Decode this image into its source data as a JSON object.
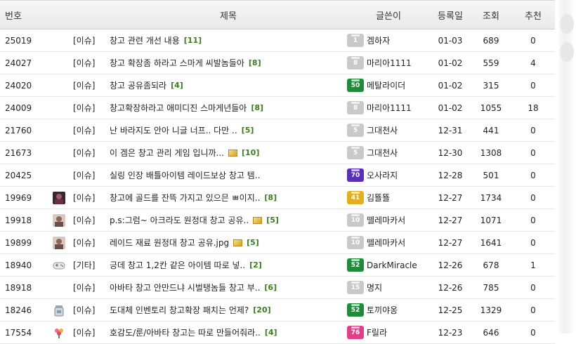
{
  "header": {
    "num": "번호",
    "title": "제목",
    "writer": "글쓴이",
    "date": "등록일",
    "views": "조회",
    "rec": "추천"
  },
  "posts": [
    {
      "num": "25019",
      "thumb": "",
      "cat": "[이슈]",
      "title": "창고 관련 개선 내용",
      "img": false,
      "comments": "[11]",
      "level": "1",
      "level_color": "#c9c9c9",
      "writer": "겜하자",
      "date": "01-03",
      "views": "689",
      "rec": "0"
    },
    {
      "num": "24027",
      "thumb": "",
      "cat": "[이슈]",
      "title": "창고 확장좀 하라고 스마게 씨발놈들아",
      "img": false,
      "comments": "[8]",
      "level": "8",
      "level_color": "#c9c9c9",
      "writer": "마리아1111",
      "date": "01-02",
      "views": "559",
      "rec": "4"
    },
    {
      "num": "24020",
      "thumb": "",
      "cat": "[이슈]",
      "title": "창고 공유좀되라",
      "img": false,
      "comments": "[4]",
      "level": "50",
      "level_color": "#1e8a3a",
      "writer": "메탈라이더",
      "date": "01-02",
      "views": "315",
      "rec": "0"
    },
    {
      "num": "24009",
      "thumb": "",
      "cat": "[이슈]",
      "title": "창고확장하라고 애미디진 스마게년들아",
      "img": false,
      "comments": "[8]",
      "level": "8",
      "level_color": "#c9c9c9",
      "writer": "마리아1111",
      "date": "01-02",
      "views": "1055",
      "rec": "18"
    },
    {
      "num": "21760",
      "thumb": "",
      "cat": "[이슈]",
      "title": "난 바라지도 안아 니글 너프.. 다만 ..",
      "img": false,
      "comments": "[5]",
      "level": "5",
      "level_color": "#c9c9c9",
      "writer": "그대천사",
      "date": "12-31",
      "views": "441",
      "rec": "0"
    },
    {
      "num": "21673",
      "thumb": "",
      "cat": "[이슈]",
      "title": "이 겜은 창고 관리 게임 입니까...",
      "img": true,
      "comments": "[10]",
      "level": "5",
      "level_color": "#c9c9c9",
      "writer": "그대천사",
      "date": "12-30",
      "views": "1308",
      "rec": "0"
    },
    {
      "num": "20425",
      "thumb": "",
      "cat": "[이슈]",
      "title": "실링 인장 배틀아이템 레이드보상 창고 템..",
      "img": false,
      "comments": "",
      "level": "70",
      "level_color": "#5a2fb8",
      "writer": "오사라지",
      "date": "12-28",
      "views": "501",
      "rec": "0"
    },
    {
      "num": "19969",
      "thumb": "portrait-dark",
      "cat": "[이슈]",
      "title": "창고에 골드를 잔뜩 가지고 있으믄 ㅃ이지..",
      "img": false,
      "comments": "[8]",
      "level": "41",
      "level_color": "#e0b020",
      "writer": "김뚈뚈",
      "date": "12-27",
      "views": "1734",
      "rec": "0"
    },
    {
      "num": "19918",
      "thumb": "portrait-light",
      "cat": "[이슈]",
      "title": "p.s:그럼~ 아크라도 원정대 창고 공유..",
      "img": true,
      "comments": "[5]",
      "level": "10",
      "level_color": "#c9c9c9",
      "writer": "뗄레마카서",
      "date": "12-27",
      "views": "1071",
      "rec": "0"
    },
    {
      "num": "19899",
      "thumb": "portrait-light",
      "cat": "[이슈]",
      "title": "레이드 재료 원정대 창고 공유.jpg",
      "img": true,
      "comments": "[5]",
      "level": "10",
      "level_color": "#c9c9c9",
      "writer": "뗄레마카서",
      "date": "12-27",
      "views": "1641",
      "rec": "0"
    },
    {
      "num": "18940",
      "thumb": "gamepad",
      "cat": "[기타]",
      "title": "긍데 창고 1,2칸 같은 아이템 따로 넣..",
      "img": false,
      "comments": "[2]",
      "level": "52",
      "level_color": "#1e8a3a",
      "writer": "DarkMiracle",
      "date": "12-26",
      "views": "678",
      "rec": "1"
    },
    {
      "num": "18918",
      "thumb": "",
      "cat": "[이슈]",
      "title": "아바타 창고 안만드냐 시벌탱놈들 창고 부..",
      "img": false,
      "comments": "[6]",
      "level": "15",
      "level_color": "#c9c9c9",
      "writer": "명지",
      "date": "12-26",
      "views": "785",
      "rec": "0"
    },
    {
      "num": "18246",
      "thumb": "jar",
      "cat": "[이슈]",
      "title": "도대체 인벤토리 창고확장 패치는 언제?",
      "img": false,
      "comments": "[20]",
      "level": "52",
      "level_color": "#1e8a3a",
      "writer": "토끼야옹",
      "date": "12-25",
      "views": "1329",
      "rec": "0"
    },
    {
      "num": "17554",
      "thumb": "flower",
      "cat": "[이슈]",
      "title": "호감도/룬/아바타 창고는 따로 만들어줘라..",
      "img": false,
      "comments": "[4]",
      "level": "76",
      "level_color": "#e0408a",
      "writer": "F릴라",
      "date": "12-23",
      "views": "646",
      "rec": "0"
    }
  ]
}
